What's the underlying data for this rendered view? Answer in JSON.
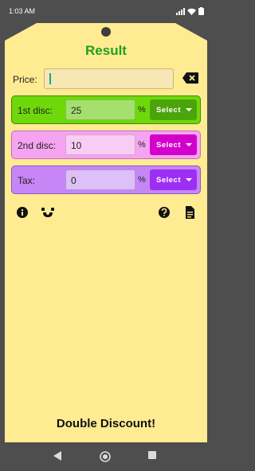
{
  "status_bar": {
    "time": "1:03 AM"
  },
  "app": {
    "title": "Result",
    "price": {
      "label": "Price:",
      "value": ""
    },
    "rows": [
      {
        "label": "1st disc:",
        "value": "25",
        "unit": "%",
        "button": "Select"
      },
      {
        "label": "2nd disc:",
        "value": "10",
        "unit": "%",
        "button": "Select"
      },
      {
        "label": "Tax:",
        "value": "0",
        "unit": "%",
        "button": "Select"
      }
    ],
    "mode_label": "Double Discount!"
  },
  "icons": {
    "backspace": "backspace-icon",
    "info": "info-icon",
    "calculator_mode": "percent-mode-icon",
    "help": "help-icon",
    "document": "document-icon"
  },
  "colors": {
    "background_tag": "#ffeb92",
    "title": "#1ea11e",
    "row1": "#6fd80a",
    "row2": "#f4a4f0",
    "row3": "#c686f6"
  }
}
